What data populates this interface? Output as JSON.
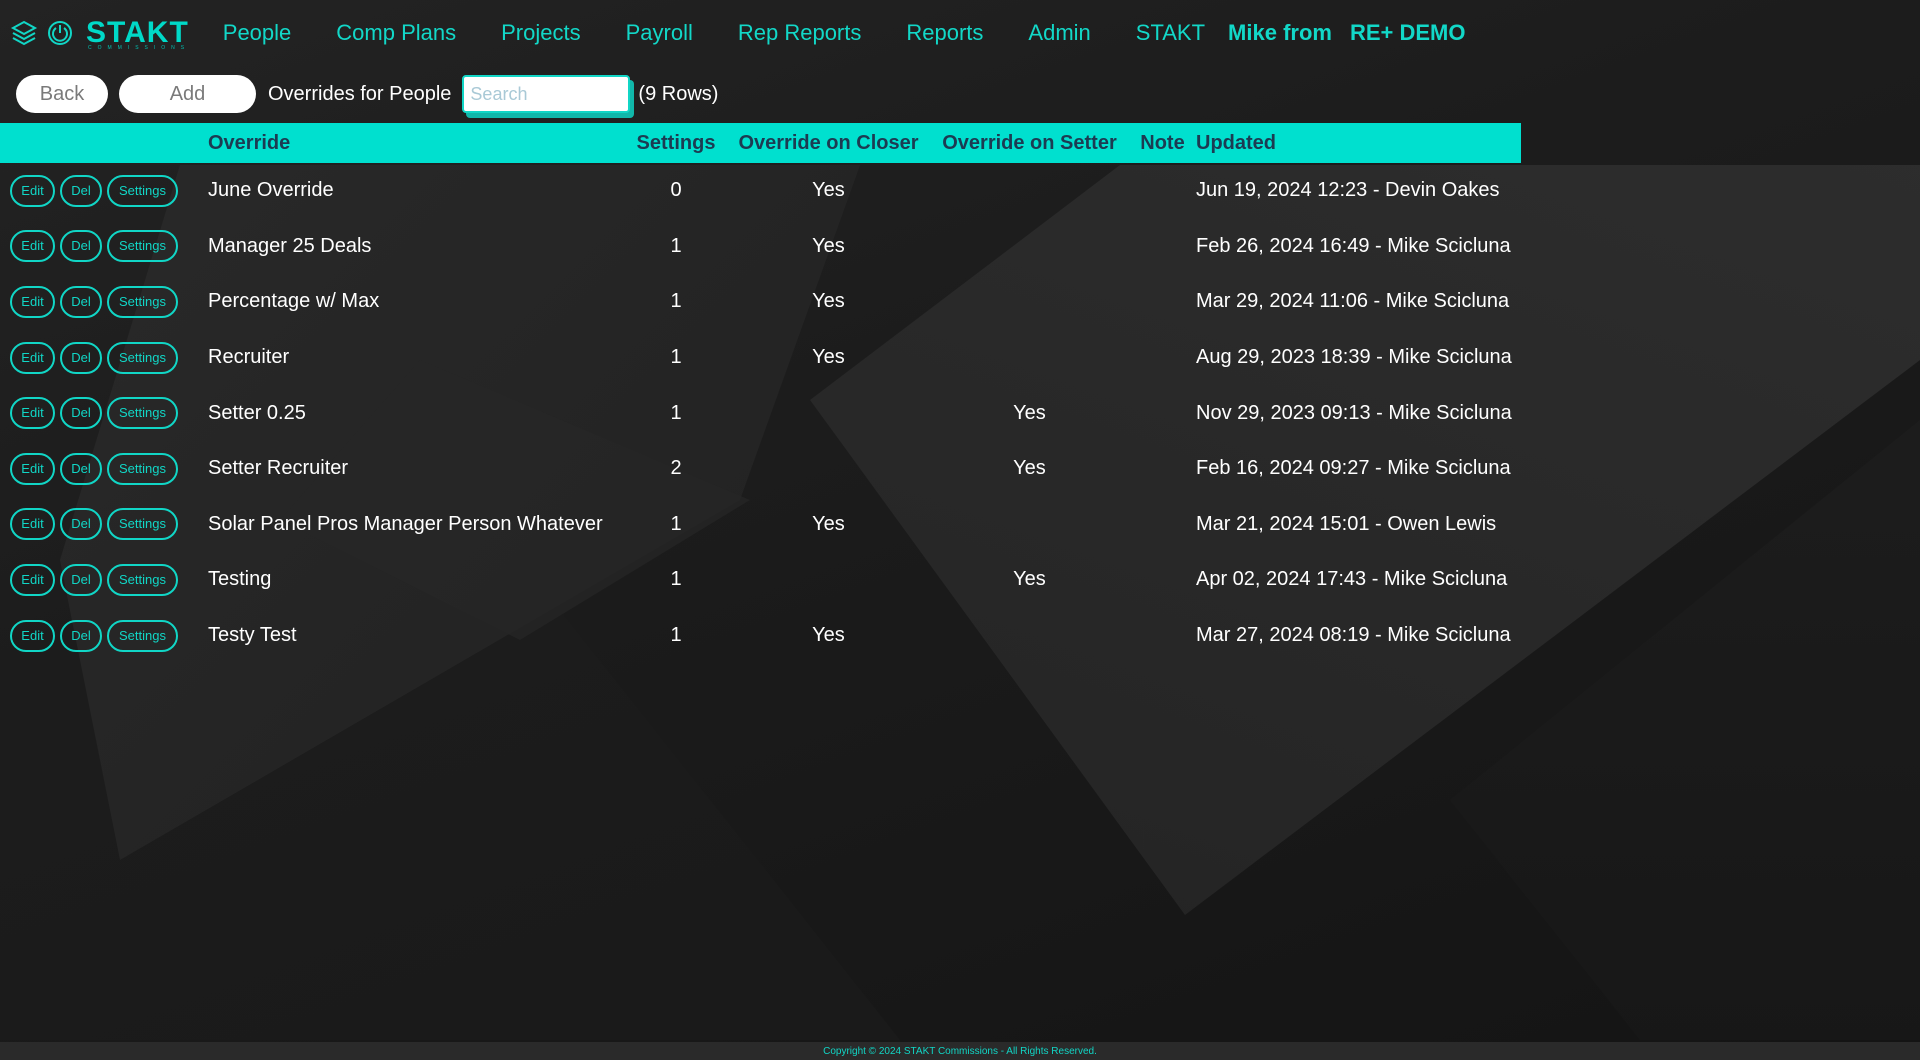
{
  "nav": {
    "brand": "STAKT",
    "brand_sub": "COMMISSIONS",
    "items": [
      {
        "label": "People"
      },
      {
        "label": "Comp Plans"
      },
      {
        "label": "Projects"
      },
      {
        "label": "Payroll"
      },
      {
        "label": "Rep Reports"
      },
      {
        "label": "Reports"
      },
      {
        "label": "Admin"
      },
      {
        "label": "STAKT"
      }
    ],
    "user": "Mike from",
    "org": "RE+ DEMO"
  },
  "toolbar": {
    "back_label": "Back",
    "add_label": "Add",
    "title": "Overrides for People",
    "search_placeholder": "Search",
    "row_count": "(9 Rows)"
  },
  "table": {
    "headers": {
      "override": "Override",
      "settings": "Settings",
      "closer": "Override on Closer",
      "setter": "Override on Setter",
      "note": "Note",
      "updated": "Updated"
    },
    "action_labels": {
      "edit": "Edit",
      "del": "Del",
      "settings": "Settings"
    },
    "rows": [
      {
        "override": "June Override",
        "settings": "0",
        "closer": "Yes",
        "setter": "",
        "note": "",
        "updated": "Jun 19, 2024 12:23 - Devin Oakes"
      },
      {
        "override": "Manager 25 Deals",
        "settings": "1",
        "closer": "Yes",
        "setter": "",
        "note": "",
        "updated": "Feb 26, 2024 16:49 - Mike Scicluna"
      },
      {
        "override": "Percentage w/ Max",
        "settings": "1",
        "closer": "Yes",
        "setter": "",
        "note": "",
        "updated": "Mar 29, 2024 11:06 - Mike Scicluna"
      },
      {
        "override": "Recruiter",
        "settings": "1",
        "closer": "Yes",
        "setter": "",
        "note": "",
        "updated": "Aug 29, 2023 18:39 - Mike Scicluna"
      },
      {
        "override": "Setter 0.25",
        "settings": "1",
        "closer": "",
        "setter": "Yes",
        "note": "",
        "updated": "Nov 29, 2023 09:13 - Mike Scicluna"
      },
      {
        "override": "Setter Recruiter",
        "settings": "2",
        "closer": "",
        "setter": "Yes",
        "note": "",
        "updated": "Feb 16, 2024 09:27 - Mike Scicluna"
      },
      {
        "override": "Solar Panel Pros Manager Person Whatever",
        "settings": "1",
        "closer": "Yes",
        "setter": "",
        "note": "",
        "updated": "Mar 21, 2024 15:01 - Owen Lewis"
      },
      {
        "override": "Testing",
        "settings": "1",
        "closer": "",
        "setter": "Yes",
        "note": "",
        "updated": "Apr 02, 2024 17:43 - Mike Scicluna"
      },
      {
        "override": "Testy Test",
        "settings": "1",
        "closer": "Yes",
        "setter": "",
        "note": "",
        "updated": "Mar 27, 2024 08:19 - Mike Scicluna"
      }
    ]
  },
  "footer": {
    "text": "Copyright © 2024 STAKT Commissions - All Rights Reserved."
  },
  "colors": {
    "accent": "#00e0cf",
    "header_text": "#1c3b52",
    "background": "#1b1b1b"
  }
}
